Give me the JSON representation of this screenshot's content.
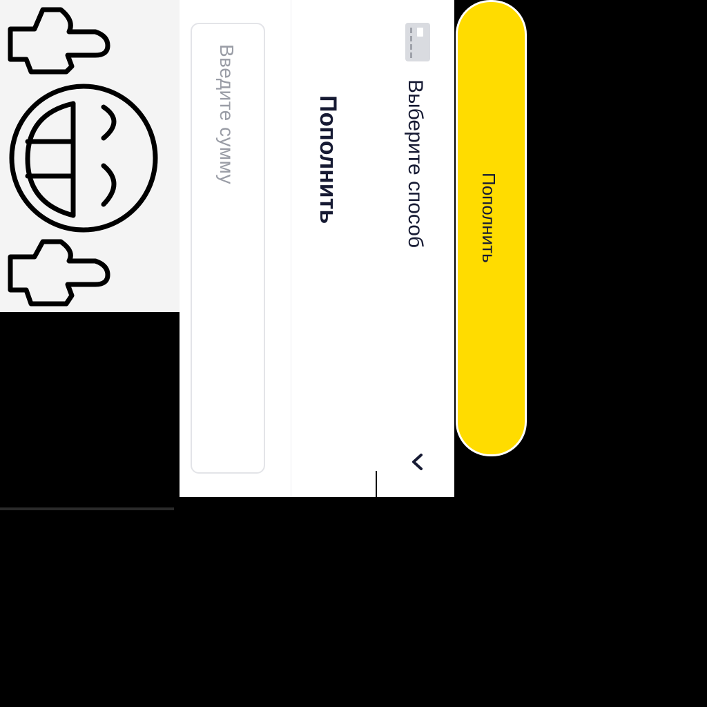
{
  "emoji_panel": {
    "icon_name": "grinning-face-pointing-hands-icon"
  },
  "topup": {
    "title": "Пополнить",
    "amount_input": {
      "value": "",
      "placeholder": "Введите сумму"
    },
    "payment_method": {
      "label": "Выберите способ",
      "icon_name": "card-icon",
      "expand_icon": "chevron-down-icon"
    },
    "submit_button": {
      "label": "Пополнить"
    }
  },
  "colors": {
    "accent": "#ffdc00",
    "text_primary": "#161a33",
    "placeholder": "#9a9da6",
    "border": "#e3e4e8",
    "background": "#000000",
    "panel": "#ffffff"
  }
}
